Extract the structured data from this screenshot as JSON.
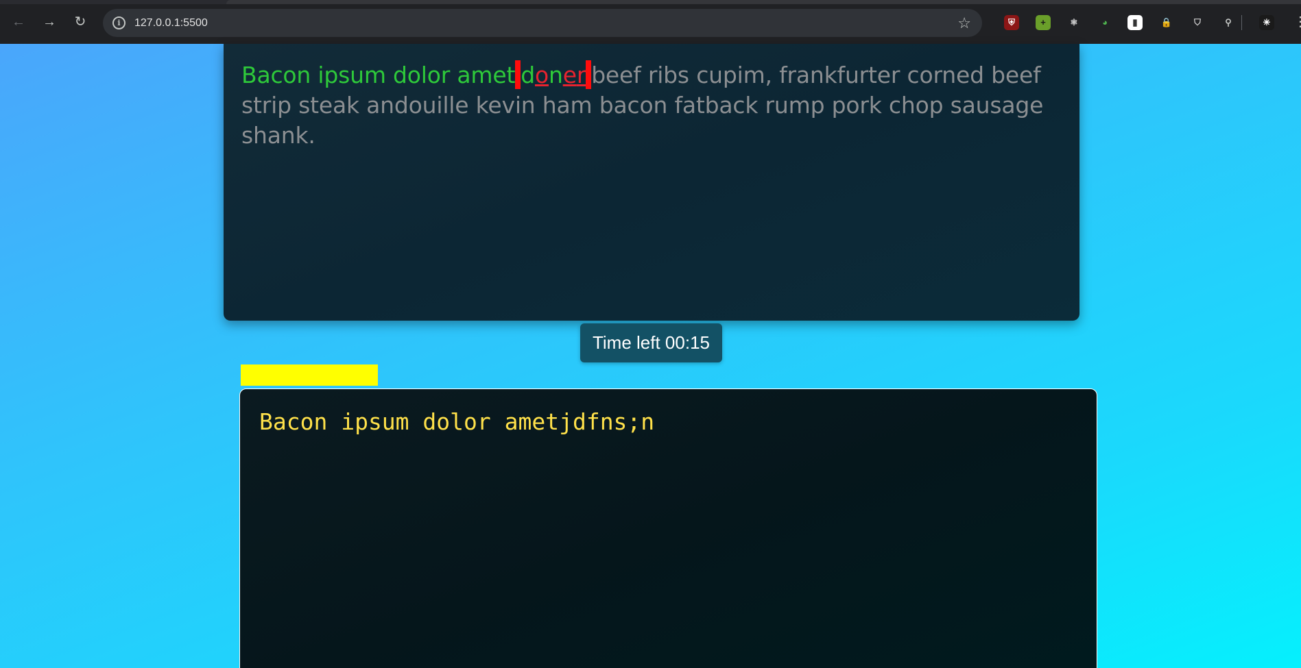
{
  "browser": {
    "url": "127.0.0.1:5500",
    "back_icon": "arrow-left-icon",
    "forward_icon": "arrow-right-icon",
    "reload_icon": "reload-icon",
    "site_info_icon": "info-icon",
    "bookmark_icon": "star-icon",
    "extensions": [
      {
        "name": "ublock-icon",
        "glyph": "⛨",
        "bg": "#8c1616",
        "fg": "#ffffff"
      },
      {
        "name": "green-plus-icon",
        "glyph": "+",
        "bg": "#6a9f2a",
        "fg": "#1a1a1a"
      },
      {
        "name": "react-devtools-icon",
        "glyph": "⚛",
        "bg": "transparent",
        "fg": "#e6e6e6"
      },
      {
        "name": "color-picker-icon",
        "glyph": "◕",
        "bg": "transparent",
        "fg": "#4fb34f"
      },
      {
        "name": "chart-icon",
        "glyph": "▮",
        "bg": "#ffffff",
        "fg": "#333333"
      },
      {
        "name": "lock-icon",
        "glyph": "🔒",
        "bg": "transparent",
        "fg": "#e5b73b"
      },
      {
        "name": "shield-icon",
        "glyph": "⛉",
        "bg": "transparent",
        "fg": "#d9d9d9"
      },
      {
        "name": "puzzle-icon",
        "glyph": "⚲",
        "bg": "transparent",
        "fg": "#c4c7c5"
      },
      {
        "name": "profile-avatar-icon",
        "glyph": "✳",
        "bg": "#1a1a1a",
        "fg": "#ffffff"
      }
    ],
    "menu_icon": "more-vertical-icon"
  },
  "quote": {
    "correct": "Bacon ipsum dolor amet",
    "current_word": [
      {
        "ch": "d",
        "state": "correct"
      },
      {
        "ch": "o",
        "state": "wrong"
      },
      {
        "ch": "n",
        "state": "correct"
      },
      {
        "ch": "e",
        "state": "wrong"
      },
      {
        "ch": "r",
        "state": "wrong"
      }
    ],
    "remaining": "beef ribs cupim, frankfurter corned beef strip steak andouille kevin ham bacon fatback rump pork chop sausage shank."
  },
  "timer": {
    "label": "Time left 00:15"
  },
  "progress": {
    "value": 0.16
  },
  "input": {
    "value": "Bacon ipsum dolor ametjdfns;n"
  },
  "colors": {
    "correct": "#2ec93a",
    "wrong": "#e8232f",
    "pending": "#8c8f92",
    "cursor": "#ff0c0c",
    "typed": "#ffe14a",
    "progress": "#ffff00"
  }
}
